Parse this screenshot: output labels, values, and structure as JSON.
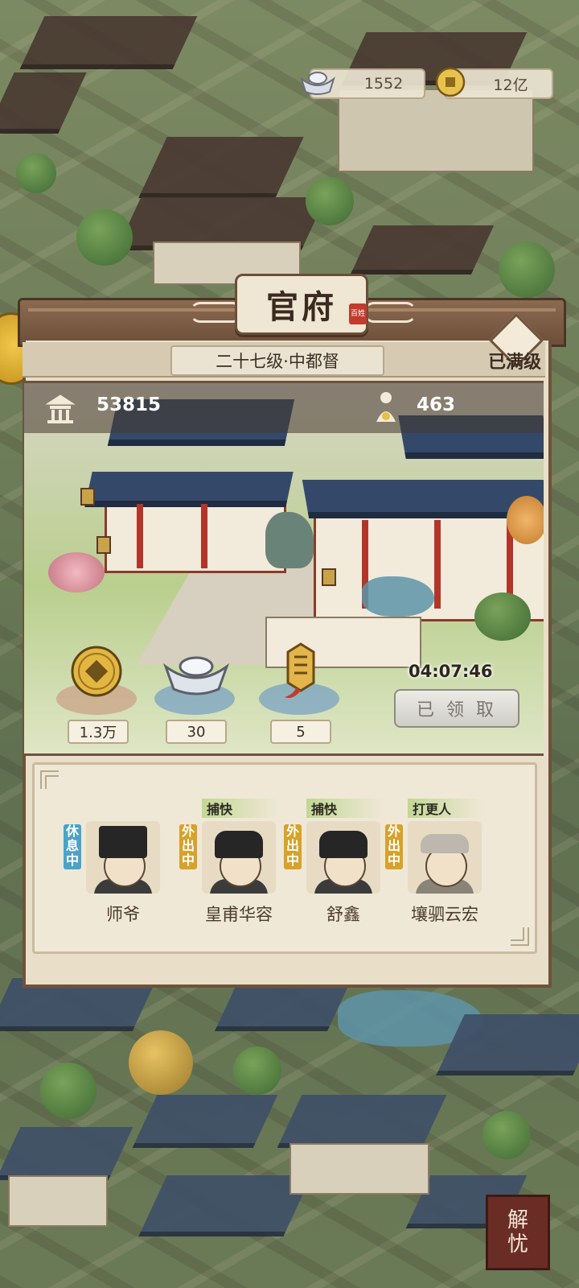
{
  "top_bar": {
    "silver_amount": "1552",
    "coin_amount": "12亿"
  },
  "panel": {
    "title": "官府",
    "stamp_text": "百姓",
    "level": "二十七级·中都督",
    "max_level_label": "已满级",
    "prestige": "53815",
    "population": "463"
  },
  "rewards": [
    {
      "icon": "copper-coin-icon",
      "amount": "1.3万"
    },
    {
      "icon": "silver-ingot-icon",
      "amount": "30"
    },
    {
      "icon": "token-plaque-icon",
      "amount": "5"
    }
  ],
  "timer": "04:07:46",
  "claim_button": "已 领 取",
  "staff": [
    {
      "status": "休息中",
      "role": "",
      "name": "师爷",
      "status_color": "#4aa3c8"
    },
    {
      "status": "外出中",
      "role": "捕快",
      "name": "皇甫华容",
      "status_color": "#d8a12a"
    },
    {
      "status": "外出中",
      "role": "捕快",
      "name": "舒鑫",
      "status_color": "#d8a12a"
    },
    {
      "status": "外出中",
      "role": "打更人",
      "name": "壤驷云宏",
      "status_color": "#d8a12a"
    }
  ],
  "corner_button": [
    "解",
    "忧"
  ]
}
